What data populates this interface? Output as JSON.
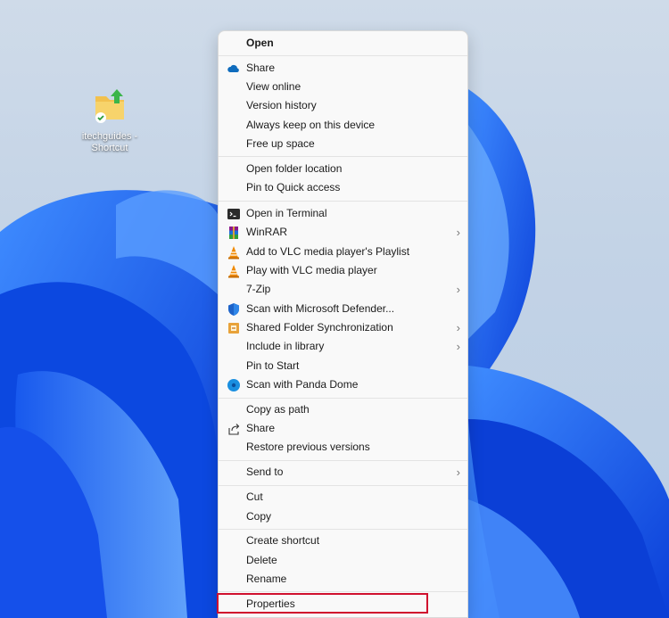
{
  "desktop": {
    "shortcut_label": "itechguides - Shortcut"
  },
  "context_menu": {
    "open": "Open",
    "share_onedrive": "Share",
    "view_online": "View online",
    "version_history": "Version history",
    "always_keep": "Always keep on this device",
    "free_up_space": "Free up space",
    "open_folder_location": "Open folder location",
    "pin_quick_access": "Pin to Quick access",
    "open_terminal": "Open in Terminal",
    "winrar": "WinRAR",
    "vlc_playlist": "Add to VLC media player's Playlist",
    "vlc_play": "Play with VLC media player",
    "seven_zip": "7-Zip",
    "scan_defender": "Scan with Microsoft Defender...",
    "shared_folder_sync": "Shared Folder Synchronization",
    "include_library": "Include in library",
    "pin_start": "Pin to Start",
    "scan_panda": "Scan with Panda Dome",
    "copy_as_path": "Copy as path",
    "share": "Share",
    "restore_versions": "Restore previous versions",
    "send_to": "Send to",
    "cut": "Cut",
    "copy": "Copy",
    "create_shortcut": "Create shortcut",
    "delete": "Delete",
    "rename": "Rename",
    "properties": "Properties",
    "submenu_chevron": "›"
  },
  "colors": {
    "highlight_border": "#d0102e",
    "onedrive_blue": "#0f6cbd",
    "vlc_orange": "#f08a00"
  }
}
